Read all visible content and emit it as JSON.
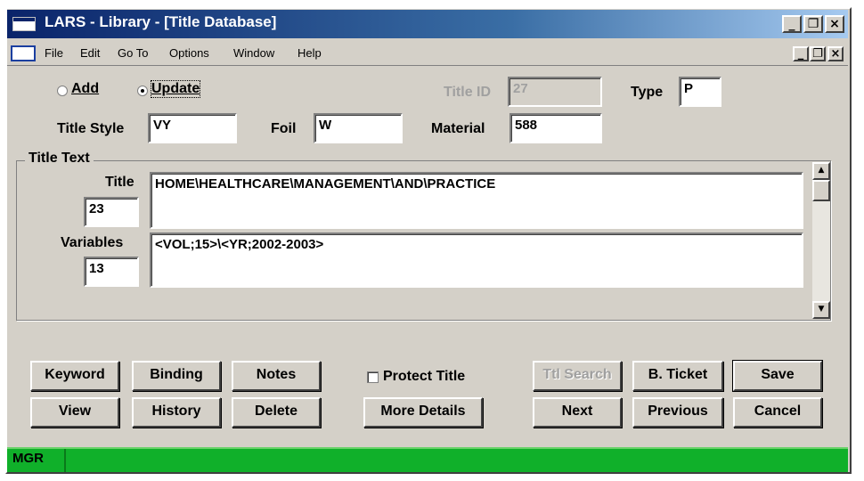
{
  "window": {
    "title": "LARS - Library - [Title Database]",
    "caption_min": "_",
    "caption_restore": "❐",
    "caption_close": "×"
  },
  "menu": {
    "items": [
      "File",
      "Edit",
      "Go To",
      "Options",
      "Window",
      "Help"
    ]
  },
  "mode": {
    "add_label": "Add",
    "update_label": "Update",
    "selected": "Update"
  },
  "fields": {
    "title_id_label": "Title ID",
    "title_id": "27",
    "type_label": "Type",
    "type": "P",
    "title_style_label": "Title Style",
    "title_style": "VY",
    "foil_label": "Foil",
    "foil": "W",
    "material_label": "Material",
    "material": "588"
  },
  "title_text": {
    "group_label": "Title Text",
    "title_label": "Title",
    "title_count": "23",
    "title_value": "HOME\\HEALTHCARE\\MANAGEMENT\\AND\\PRACTICE",
    "variables_label": "Variables",
    "variables_count": "13",
    "variables_value": "<VOL;15>\\<YR;2002-2003>"
  },
  "buttons": {
    "keyword": "Keyword",
    "binding": "Binding",
    "notes": "Notes",
    "view": "View",
    "history": "History",
    "delete": "Delete",
    "protect_title": "Protect Title",
    "more_details": "More Details",
    "ttl_search": "Ttl Search",
    "b_ticket": "B. Ticket",
    "save": "Save",
    "next": "Next",
    "previous": "Previous",
    "cancel": "Cancel"
  },
  "status": {
    "user": "MGR"
  },
  "colors": {
    "titlebar": "#0a246a",
    "statusbar": "#10b02a",
    "face": "#d4d0c8"
  },
  "icons": [
    "app-icon",
    "document-icon",
    "scroll-up-icon",
    "scroll-down-icon"
  ]
}
